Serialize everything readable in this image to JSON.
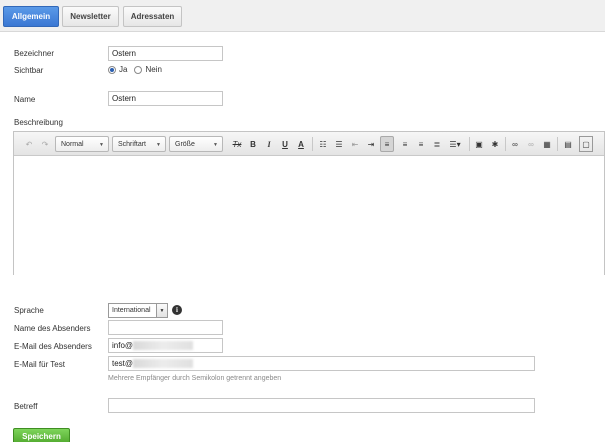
{
  "tabs": [
    {
      "label": "Allgemein",
      "active": true
    },
    {
      "label": "Newsletter",
      "active": false
    },
    {
      "label": "Adressaten",
      "active": false
    }
  ],
  "form": {
    "bezeichner_label": "Bezeichner",
    "bezeichner_value": "Ostern",
    "sichtbar_label": "Sichtbar",
    "sichtbar_options": [
      "Ja",
      "Nein"
    ],
    "sichtbar_selected": "Ja",
    "name_label": "Name",
    "name_value": "Ostern",
    "beschreibung_label": "Beschreibung",
    "sprache_label": "Sprache",
    "sprache_value": "International",
    "absender_name_label": "Name des Absenders",
    "absender_name_value": "",
    "absender_email_label": "E-Mail des Absenders",
    "absender_email_value": "info@",
    "test_email_label": "E-Mail für Test",
    "test_email_value": "test@",
    "test_email_hint": "Mehrere Empfänger durch Semikolon getrennt angeben",
    "betreff_label": "Betreff",
    "betreff_value": "",
    "save_label": "Speichern"
  },
  "editor": {
    "format_combo": "Normal",
    "font_combo": "Schriftart",
    "size_combo": "Größe",
    "bold": "B",
    "italic": "I",
    "underline": "U",
    "font_color": "A",
    "clear_format": "Tx"
  },
  "colors": {
    "tab_active": "#3a77d3",
    "save_button": "#4fa72c"
  }
}
